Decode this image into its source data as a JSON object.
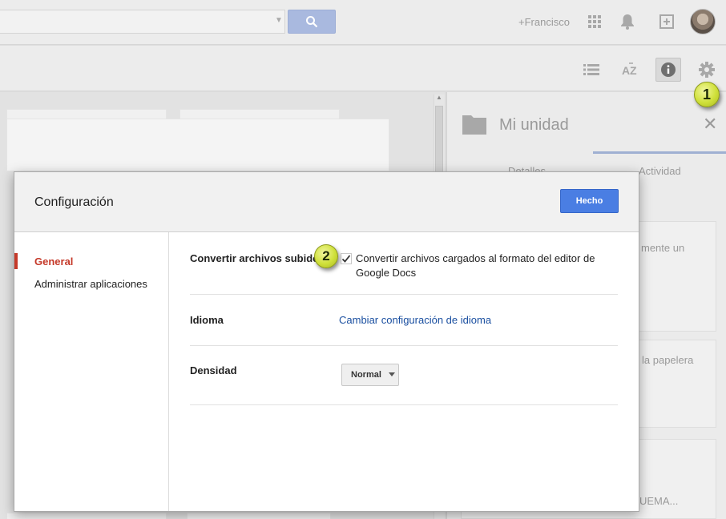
{
  "topbar": {
    "user_name": "+Francisco",
    "icons": [
      "search-icon",
      "apps-grid-icon",
      "notifications-bell-icon",
      "share-plus-icon",
      "avatar"
    ]
  },
  "toolbar": {
    "icons": [
      "list-view-icon",
      "sort-az-icon",
      "info-icon",
      "gear-icon"
    ]
  },
  "details_panel": {
    "title": "Mi unidad",
    "tabs": [
      "Detalles",
      "Actividad"
    ],
    "snippets": [
      "mente un",
      "la papelera",
      "UEMA..."
    ]
  },
  "annotations": {
    "badge_1": "1",
    "badge_2": "2",
    "badge_color": "#cfe03a"
  },
  "dialog": {
    "title": "Configuración",
    "done_label": "Hecho",
    "nav": {
      "general": "General",
      "manage_apps": "Administrar aplicaciones"
    },
    "convert": {
      "label": "Convertir archivos subidos",
      "checked": true,
      "text": "Convertir archivos cargados al formato del editor de Google Docs"
    },
    "language": {
      "label": "Idioma",
      "link": "Cambiar configuración de idioma"
    },
    "density": {
      "label": "Densidad",
      "selected": "Normal"
    }
  },
  "colors": {
    "primary_button": "#4a7ee3",
    "active_nav": "#c53929",
    "link": "#1a4fa0"
  }
}
